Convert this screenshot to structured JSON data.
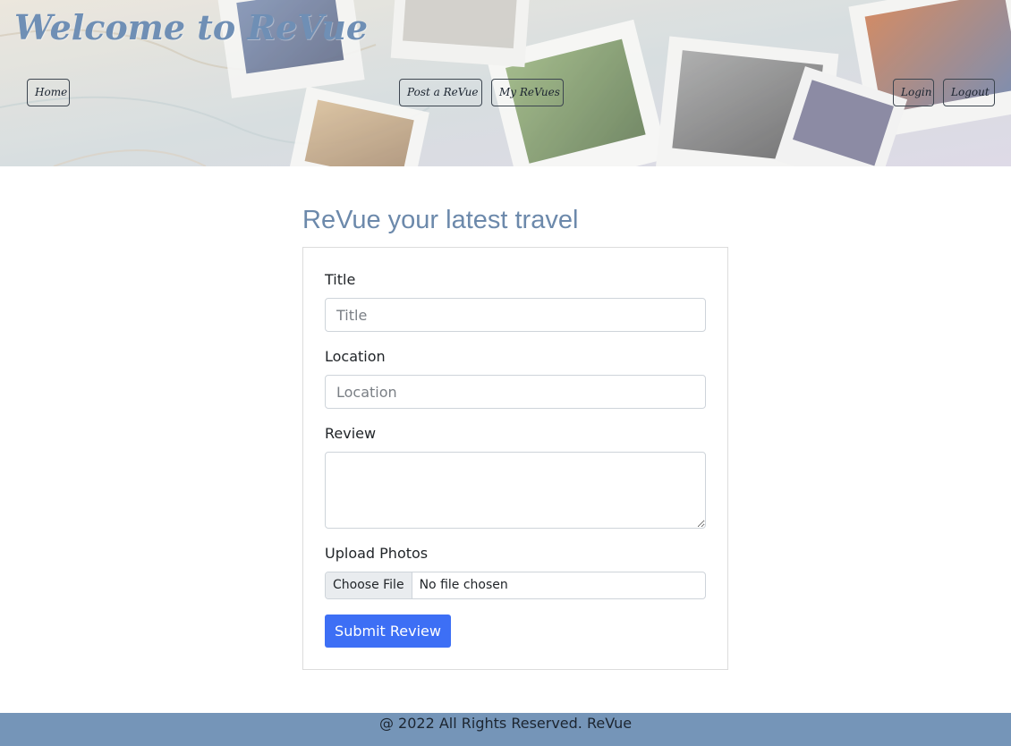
{
  "header": {
    "title": "Welcome to ReVue",
    "nav": {
      "home": "Home",
      "post": "Post a ReVue",
      "mine": "My ReVues",
      "login": "Login",
      "logout": "Logout"
    }
  },
  "form": {
    "heading": "ReVue your latest travel",
    "title_label": "Title",
    "title_placeholder": "Title",
    "title_value": "",
    "location_label": "Location",
    "location_placeholder": "Location",
    "location_value": "",
    "review_label": "Review",
    "review_value": "",
    "upload_label": "Upload Photos",
    "choose_file_label": "Choose File",
    "file_status": "No file chosen",
    "submit_label": "Submit Review"
  },
  "footer": {
    "text": "@ 2022 All Rights Reserved. ReVue"
  },
  "colors": {
    "title_blue": "#6f8fb5",
    "heading_blue": "#6c89ab",
    "submit_blue": "#3d6ff5",
    "footer_bg": "#7595b8"
  },
  "icons": {
    "hero_background": "scattered-photos-image"
  }
}
